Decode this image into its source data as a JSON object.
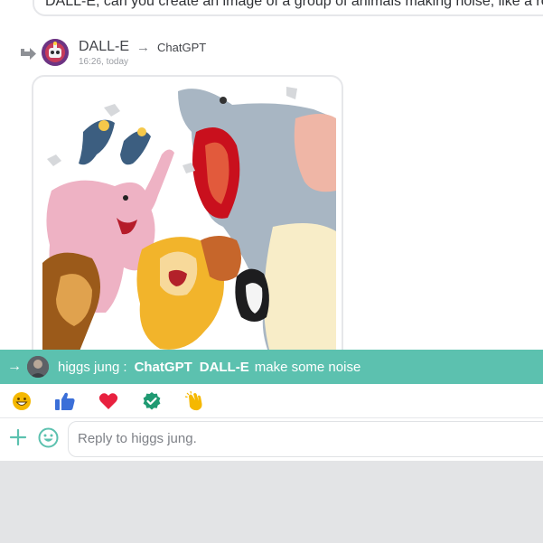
{
  "previous_message": {
    "text": "DALL-E, can you create an image of a group of animals making noise, like a roar"
  },
  "message": {
    "sender": "DALL-E",
    "forward_target": "ChatGPT",
    "arrow": "→",
    "time": "16:26, today",
    "image_icon": "cartoon-animals-image"
  },
  "quote": {
    "arrow": "→",
    "author": "higgs jung",
    "separator": ":",
    "mention_1": "ChatGPT",
    "mention_2": "DALL-E",
    "text": "make some noise",
    "bar_color": "#5cc1af"
  },
  "reactions": [
    {
      "icon": "grinning-face-icon"
    },
    {
      "icon": "thumbs-up-icon"
    },
    {
      "icon": "heart-icon"
    },
    {
      "icon": "check-badge-icon"
    },
    {
      "icon": "clapping-hands-icon"
    }
  ],
  "composer": {
    "placeholder": "Reply to higgs jung."
  },
  "colors": {
    "accent": "#5cc1af",
    "heart": "#e8213f",
    "thumb": "#3b6fd8",
    "check": "#1f9a72",
    "emoji": "#f5b800"
  }
}
